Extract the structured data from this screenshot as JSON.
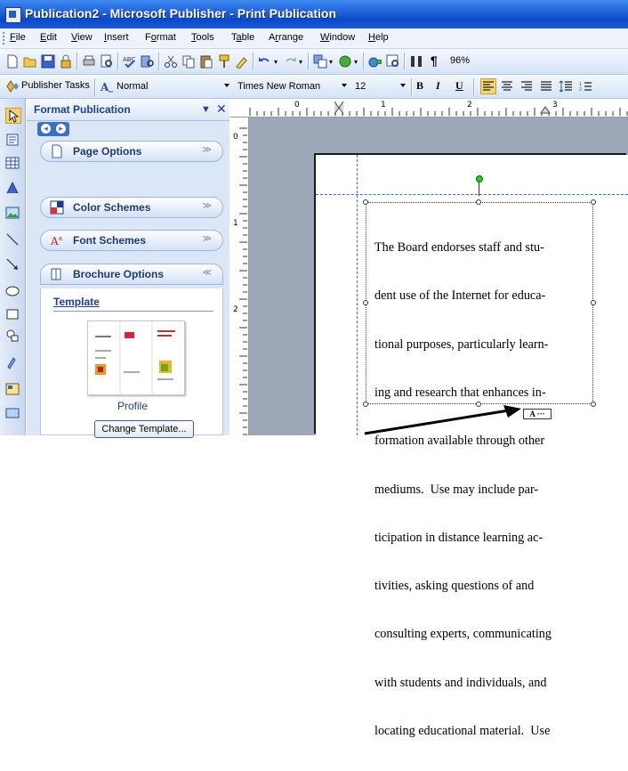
{
  "window": {
    "title": "Publication2 - Microsoft Publisher - Print Publication"
  },
  "menu": {
    "items": [
      {
        "label": "File",
        "key": "F",
        "rest": "ile"
      },
      {
        "label": "Edit",
        "key": "E",
        "rest": "dit"
      },
      {
        "label": "View",
        "key": "V",
        "rest": "iew"
      },
      {
        "label": "Insert",
        "key": "I",
        "rest": "nsert"
      },
      {
        "label": "Format",
        "key": "o",
        "pre": "F",
        "rest": "rmat"
      },
      {
        "label": "Tools",
        "key": "T",
        "rest": "ools"
      },
      {
        "label": "Table",
        "key": "a",
        "pre": "T",
        "rest": "ble"
      },
      {
        "label": "Arrange",
        "key": "r",
        "pre": "A",
        "rest": "range"
      },
      {
        "label": "Window",
        "key": "W",
        "rest": "indow"
      },
      {
        "label": "Help",
        "key": "H",
        "rest": "elp"
      }
    ]
  },
  "toolbar": {
    "zoom": "96%"
  },
  "formatting": {
    "publisher_tasks": "Publisher Tasks",
    "style": "Normal",
    "font": "Times New Roman",
    "size": "12",
    "bold": "B",
    "italic": "I",
    "underline": "U"
  },
  "task_pane": {
    "title": "Format Publication",
    "sections": [
      {
        "label": "Page Options",
        "icon": "page-icon"
      },
      {
        "label": "Color Schemes",
        "icon": "color-schemes-icon"
      },
      {
        "label": "Font Schemes",
        "icon": "font-schemes-icon"
      },
      {
        "label": "Brochure Options",
        "icon": "brochure-icon"
      }
    ],
    "template_heading": "Template",
    "template_name": "Profile",
    "change_template_label": "Change Template..."
  },
  "ruler": {
    "corner": "L",
    "h_labels": [
      "0",
      "1",
      "2",
      "3"
    ],
    "v_labels": [
      "0",
      "1",
      "2"
    ]
  },
  "document": {
    "text_lines": [
      "The Board endorses staff and stu-",
      "dent use of the Internet for educa-",
      "tional purposes, particularly learn-",
      "ing and research that enhances in-",
      "formation available through other",
      "mediums.  Use may include par-",
      "ticipation in distance learning ac-",
      "tivities, asking questions of and",
      "consulting experts, communicating",
      "with students and individuals, and",
      "locating educational material.  Use"
    ],
    "overflow_indicator": "A ···"
  }
}
